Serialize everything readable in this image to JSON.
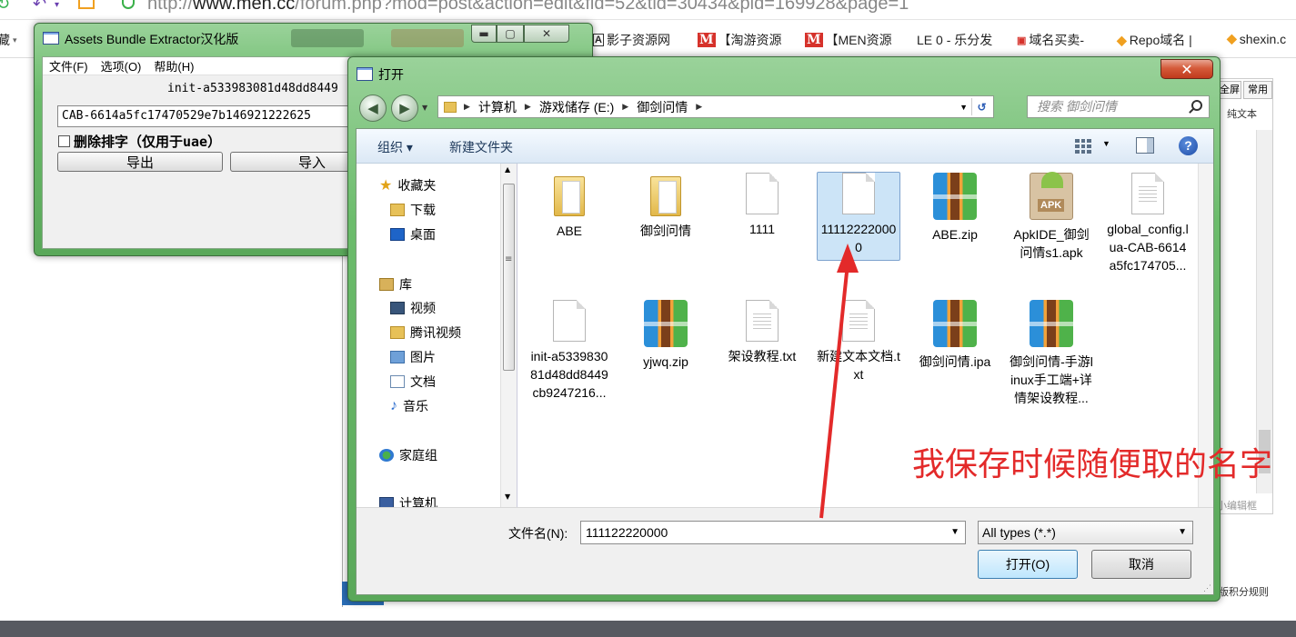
{
  "browser": {
    "url_prefix": "http://",
    "url_domain": "www.men.cc",
    "url_path": "/forum.php?mod=post&action=edit&fid=52&tid=30434&pid=169928&page=1",
    "bookmarks": [
      {
        "icon": "shadow-icon",
        "label": "影子资源网"
      },
      {
        "icon": "m-logo-icon",
        "label": "【淘游资源"
      },
      {
        "icon": "m-logo-icon",
        "label": "【MEN资源"
      },
      {
        "icon": "le-logo-icon",
        "label": "LE 0 - 乐分发"
      },
      {
        "icon": "domain-icon",
        "label": "域名买卖-"
      },
      {
        "icon": "diamond-icon",
        "label": "Repo域名 |"
      },
      {
        "icon": "diamond-icon",
        "label": "shexin.c"
      }
    ],
    "left_stub": "藏",
    "editor": {
      "btn_fullscreen": "全屏",
      "btn_common": "常用",
      "label_plaintext": "纯文本",
      "footer": "小编辑框",
      "rules_link": "版积分规则"
    }
  },
  "abe": {
    "title": "Assets Bundle Extractor汉化版",
    "menu": [
      "文件(F)",
      "选项(O)",
      "帮助(H)"
    ],
    "init_text": "init-a533983081d48dd8449",
    "cab_value": "CAB-6614a5fc17470529e7b146921222625",
    "checkbox_label": "删除排字（仅用于uae）",
    "export_label": "导出",
    "import_label": "导入"
  },
  "dialog": {
    "title": "打开",
    "close_label": "✕",
    "breadcrumb": [
      "计算机",
      "游戏储存 (E:)",
      "御剑问情"
    ],
    "search_placeholder": "搜索 御剑问情",
    "toolbar": {
      "organize": "组织 ▾",
      "new_folder": "新建文件夹"
    },
    "nav": [
      {
        "icon": "star-icon",
        "label": "收藏夹"
      },
      {
        "icon": "download-folder-icon",
        "label": "下载"
      },
      {
        "icon": "desktop-icon",
        "label": "桌面"
      },
      {
        "icon": "library-icon",
        "label": "库"
      },
      {
        "icon": "video-icon",
        "label": "视频"
      },
      {
        "icon": "folder-icon",
        "label": "腾讯视频"
      },
      {
        "icon": "pictures-icon",
        "label": "图片"
      },
      {
        "icon": "documents-icon",
        "label": "文档"
      },
      {
        "icon": "music-icon",
        "label": "音乐"
      },
      {
        "icon": "homegroup-icon",
        "label": "家庭组"
      },
      {
        "icon": "computer-icon",
        "label": "计算机"
      }
    ],
    "files": [
      {
        "name": "ABE",
        "type": "folder",
        "selected": false
      },
      {
        "name": "御剑问情",
        "type": "folder",
        "selected": false
      },
      {
        "name": "1111",
        "type": "file",
        "selected": false
      },
      {
        "name": "111122220000",
        "type": "file",
        "selected": true
      },
      {
        "name": "ABE.zip",
        "type": "zip",
        "selected": false
      },
      {
        "name": "ApkIDE_御剑问情s1.apk",
        "type": "apk",
        "selected": false
      },
      {
        "name": "global_config.lua-CAB-6614a5fc174705...",
        "type": "txt",
        "selected": false
      },
      {
        "name": "init-a533983081d48dd8449cb9247216...",
        "type": "file",
        "selected": false
      },
      {
        "name": "yjwq.zip",
        "type": "zip",
        "selected": false
      },
      {
        "name": "架设教程.txt",
        "type": "txt",
        "selected": false
      },
      {
        "name": "新建文本文档.txt",
        "type": "txt",
        "selected": false
      },
      {
        "name": "御剑问情.ipa",
        "type": "zip",
        "selected": false
      },
      {
        "name": "御剑问情-手游linux手工端+详情架设教程...",
        "type": "zip",
        "selected": false
      }
    ],
    "filename_label": "文件名(N):",
    "filename_value": "111122220000",
    "filetype_value": "All types (*.*)",
    "open_label": "打开(O)",
    "cancel_label": "取消",
    "apk_badge": "APK"
  },
  "annotation": {
    "text": "我保存时候随便取的名字",
    "color": "#e32a2a"
  }
}
